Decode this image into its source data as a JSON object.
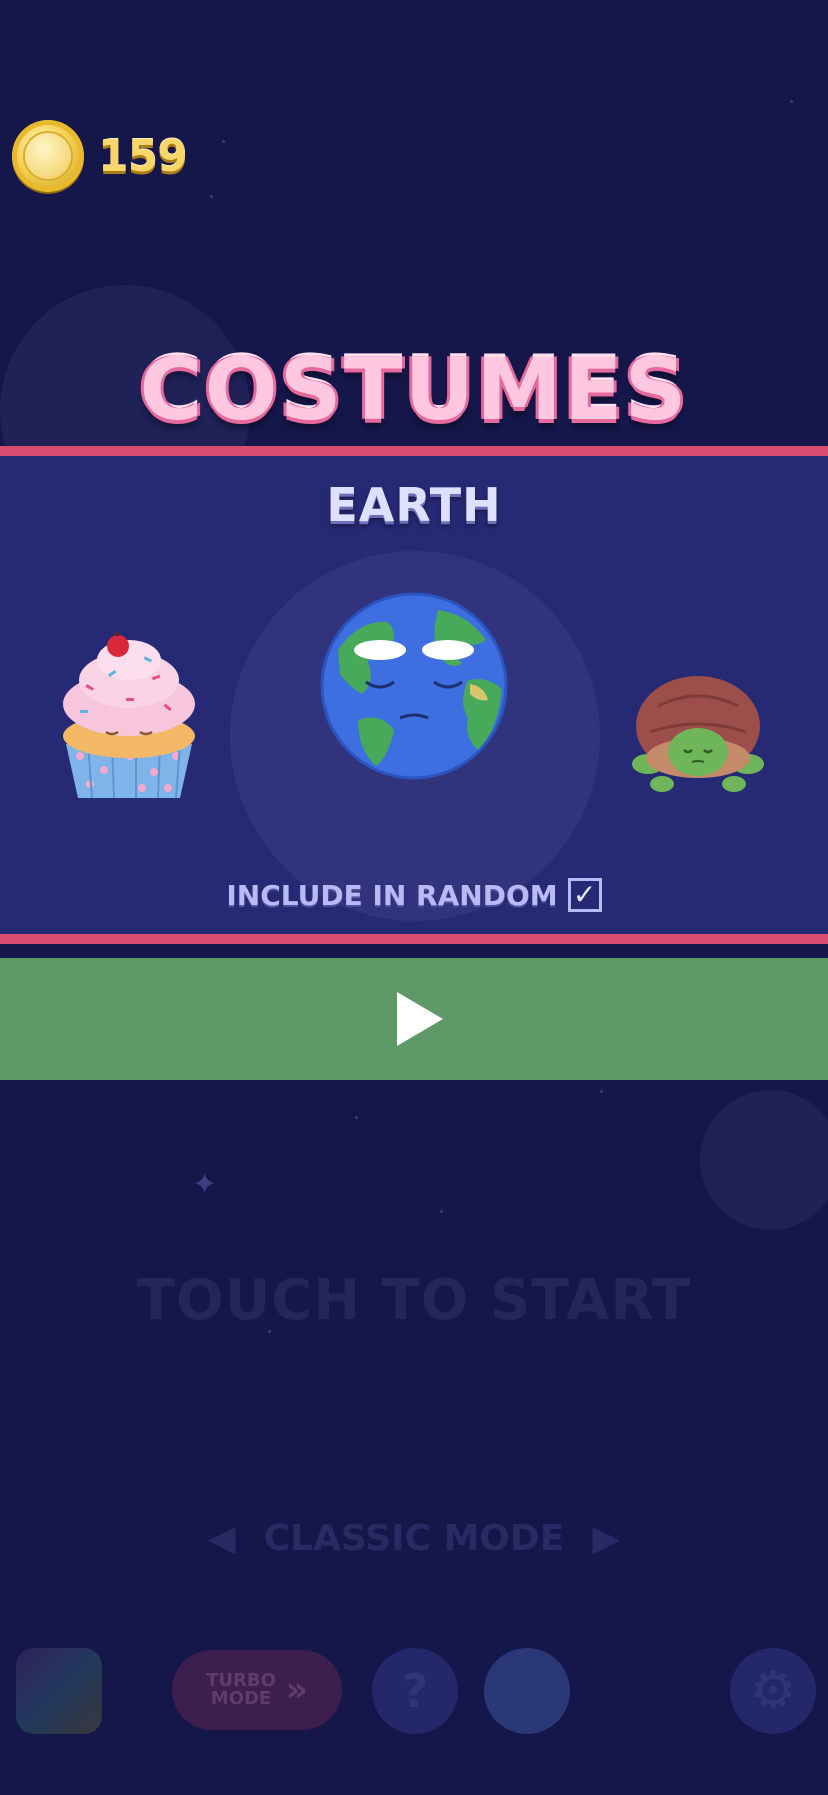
{
  "coins": {
    "count": "159"
  },
  "costumes": {
    "title": "COSTUMES",
    "selected_name": "EARTH",
    "include_random_label": "INCLUDE IN RANDOM",
    "include_random_checked": true,
    "items": [
      "cupcake",
      "earth",
      "turtle"
    ]
  },
  "background": {
    "touch_to_start": "TOUCH TO START",
    "mode_label": "CLASSIC MODE",
    "mode_prev_glyph": "◀",
    "mode_next_glyph": "▶",
    "turbo_line1": "TURBO",
    "turbo_line2": "MODE",
    "turbo_arrows": "»",
    "help_glyph": "?",
    "settings_glyph": "⚙"
  },
  "colors": {
    "background": "#15164a",
    "panel": "#262973",
    "panel_border": "#d94d70",
    "play_bar": "#5e9968",
    "title": "#ffc7e0",
    "coin_text": "#f7d76a"
  },
  "icons": [
    "coin-icon",
    "play-icon",
    "checkbox-check-icon",
    "settings-icon",
    "help-icon",
    "moon-face-icon",
    "rainbow-icon"
  ]
}
